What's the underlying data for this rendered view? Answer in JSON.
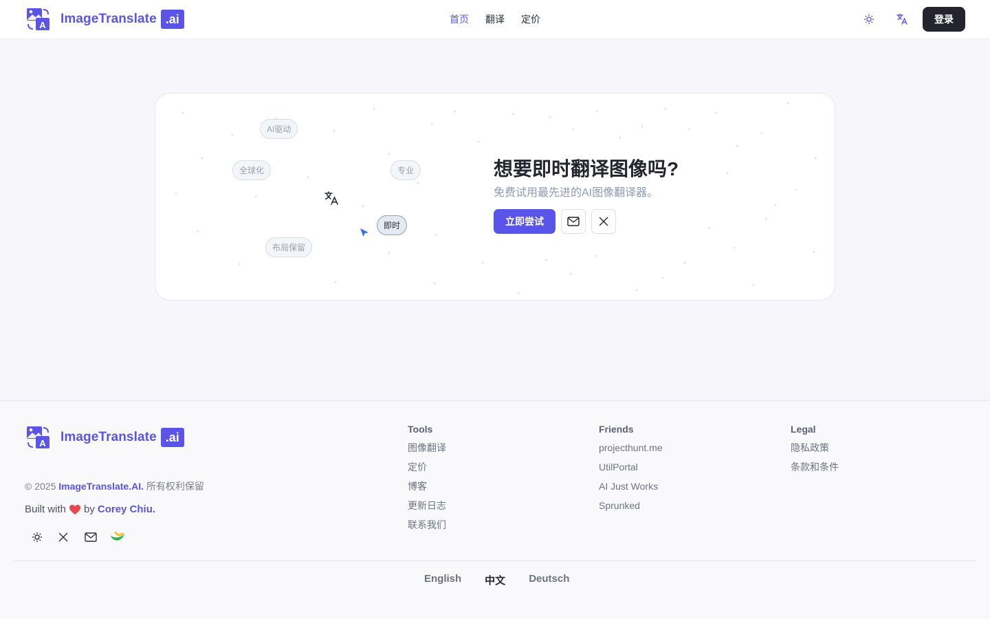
{
  "header": {
    "brand_name": "ImageTranslate",
    "brand_tld": ".ai",
    "nav": [
      {
        "label": "首页",
        "active": true
      },
      {
        "label": "翻译",
        "active": false
      },
      {
        "label": "定价",
        "active": false
      }
    ],
    "theme_icon": "sun-icon",
    "language_icon": "translate-icon",
    "login_label": "登录"
  },
  "hero": {
    "pills": [
      "AI驱动",
      "全球化",
      "专业",
      "即时",
      "布局保留"
    ],
    "active_pill": "即时",
    "title": "想要即时翻译图像吗?",
    "subtitle": "免费试用最先进的AI图像翻译器。",
    "cta_label": "立即尝试",
    "buttons": [
      "mail-icon",
      "x-logo-icon"
    ]
  },
  "footer": {
    "brand_name": "ImageTranslate",
    "brand_tld": ".ai",
    "copyright_prefix": "© 2025",
    "copyright_brand": "ImageTranslate.AI.",
    "copyright_suffix": "所有权利保留",
    "built_prefix": "Built with",
    "built_by": "by",
    "built_author": "Corey Chiu.",
    "social_icons": [
      "sun-icon",
      "x-logo-icon",
      "mail-icon",
      "leaf-logo-icon"
    ],
    "columns": [
      {
        "title": "Tools",
        "links": [
          "图像翻译",
          "定价",
          "博客",
          "更新日志",
          "联系我们"
        ]
      },
      {
        "title": "Friends",
        "links": [
          "projecthunt.me",
          "UtilPortal",
          "AI Just Works",
          "Sprunked"
        ]
      },
      {
        "title": "Legal",
        "links": [
          "隐私政策",
          "条款和条件"
        ]
      }
    ],
    "languages": [
      {
        "label": "English",
        "active": false
      },
      {
        "label": "中文",
        "active": true
      },
      {
        "label": "Deutsch",
        "active": false
      }
    ]
  },
  "colors": {
    "accent": "#5b54e8",
    "dark": "#23242e",
    "muted": "#8f9bb3"
  }
}
